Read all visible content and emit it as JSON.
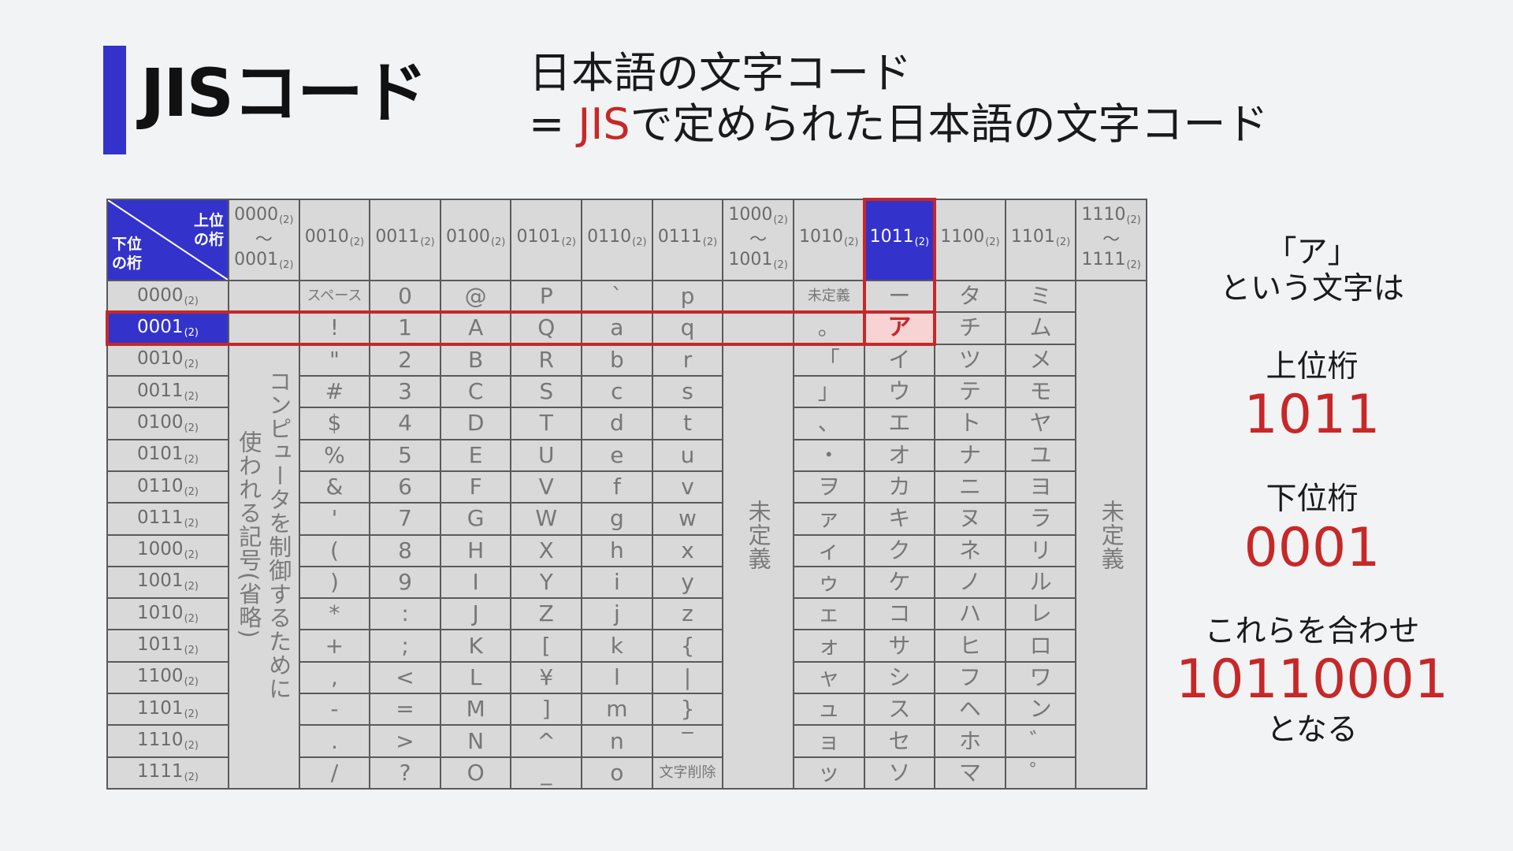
{
  "slide": {
    "title": "JISコード",
    "subtitle_line1": "日本語の文字コード",
    "subtitle_line2_prefix": "= ",
    "subtitle_line2_highlight": "JIS",
    "subtitle_line2_suffix": "で定められた日本語の文字コード"
  },
  "colors": {
    "accent_blue": "#3333cc",
    "highlight_red": "#c62828",
    "background": "#f2f3f5",
    "table_cell": "#d9d9d9",
    "table_line": "#5a5a5a",
    "highlight_cell": "#f8d3d3",
    "cell_text": "#777777"
  },
  "table": {
    "radix": "(2)",
    "range_mark": "〜",
    "corner": {
      "upper_line1": "上位",
      "upper_line2": "の桁",
      "lower_line1": "下位",
      "lower_line2": "の桁"
    },
    "columns": [
      {
        "from": "0000",
        "to": "0001",
        "merged_lines": [
          "コンピュータを制御するために",
          "使われる記号(省略)"
        ]
      },
      {
        "code": "0010",
        "chars": [
          "スペース",
          "!",
          "\"",
          "#",
          "$",
          "%",
          "&",
          "'",
          "(",
          ")",
          "*",
          "+",
          ",",
          "-",
          ".",
          "/"
        ]
      },
      {
        "code": "0011",
        "chars": [
          "0",
          "1",
          "2",
          "3",
          "4",
          "5",
          "6",
          "7",
          "8",
          "9",
          ":",
          ";",
          "<",
          "=",
          ">",
          "?"
        ]
      },
      {
        "code": "0100",
        "chars": [
          "@",
          "A",
          "B",
          "C",
          "D",
          "E",
          "F",
          "G",
          "H",
          "I",
          "J",
          "K",
          "L",
          "M",
          "N",
          "O"
        ]
      },
      {
        "code": "0101",
        "chars": [
          "P",
          "Q",
          "R",
          "S",
          "T",
          "U",
          "V",
          "W",
          "X",
          "Y",
          "Z",
          "[",
          "¥",
          "]",
          "^",
          "_"
        ]
      },
      {
        "code": "0110",
        "chars": [
          "`",
          "a",
          "b",
          "c",
          "d",
          "e",
          "f",
          "g",
          "h",
          "i",
          "j",
          "k",
          "l",
          "m",
          "n",
          "o"
        ]
      },
      {
        "code": "0111",
        "chars": [
          "p",
          "q",
          "r",
          "s",
          "t",
          "u",
          "v",
          "w",
          "x",
          "y",
          "z",
          "{",
          "|",
          "}",
          "‾",
          "文字削除"
        ]
      },
      {
        "from": "1000",
        "to": "1001",
        "merged_lines": [
          "未定義"
        ]
      },
      {
        "code": "1010",
        "chars": [
          "未定義",
          "。",
          "「",
          "」",
          "、",
          "・",
          "ヲ",
          "ァ",
          "ィ",
          "ゥ",
          "ェ",
          "ォ",
          "ャ",
          "ュ",
          "ョ",
          "ッ"
        ]
      },
      {
        "code": "1011",
        "highlight": true,
        "chars": [
          "ー",
          "ア",
          "イ",
          "ウ",
          "エ",
          "オ",
          "カ",
          "キ",
          "ク",
          "ケ",
          "コ",
          "サ",
          "シ",
          "ス",
          "セ",
          "ソ"
        ]
      },
      {
        "code": "1100",
        "chars": [
          "タ",
          "チ",
          "ツ",
          "テ",
          "ト",
          "ナ",
          "ニ",
          "ヌ",
          "ネ",
          "ノ",
          "ハ",
          "ヒ",
          "フ",
          "ヘ",
          "ホ",
          "マ"
        ]
      },
      {
        "code": "1101",
        "chars": [
          "ミ",
          "ム",
          "メ",
          "モ",
          "ヤ",
          "ユ",
          "ヨ",
          "ラ",
          "リ",
          "ル",
          "レ",
          "ロ",
          "ワ",
          "ン",
          "゛",
          "゜"
        ]
      },
      {
        "from": "1110",
        "to": "1111",
        "merged_lines": [
          "未定義"
        ]
      }
    ],
    "rows": [
      {
        "code": "0000"
      },
      {
        "code": "0001",
        "highlight": true
      },
      {
        "code": "0010"
      },
      {
        "code": "0011"
      },
      {
        "code": "0100"
      },
      {
        "code": "0101"
      },
      {
        "code": "0110"
      },
      {
        "code": "0111"
      },
      {
        "code": "1000"
      },
      {
        "code": "1001"
      },
      {
        "code": "1010"
      },
      {
        "code": "1011"
      },
      {
        "code": "1100"
      },
      {
        "code": "1101"
      },
      {
        "code": "1110"
      },
      {
        "code": "1111"
      }
    ]
  },
  "explanation": {
    "character": "「ア」",
    "character_suffix": "という文字は",
    "upper_label": "上位桁",
    "upper_value": "1011",
    "lower_label": "下位桁",
    "lower_value": "0001",
    "combine_label": "これらを合わせ",
    "combined_value": "10110001",
    "result_label": "となる"
  }
}
